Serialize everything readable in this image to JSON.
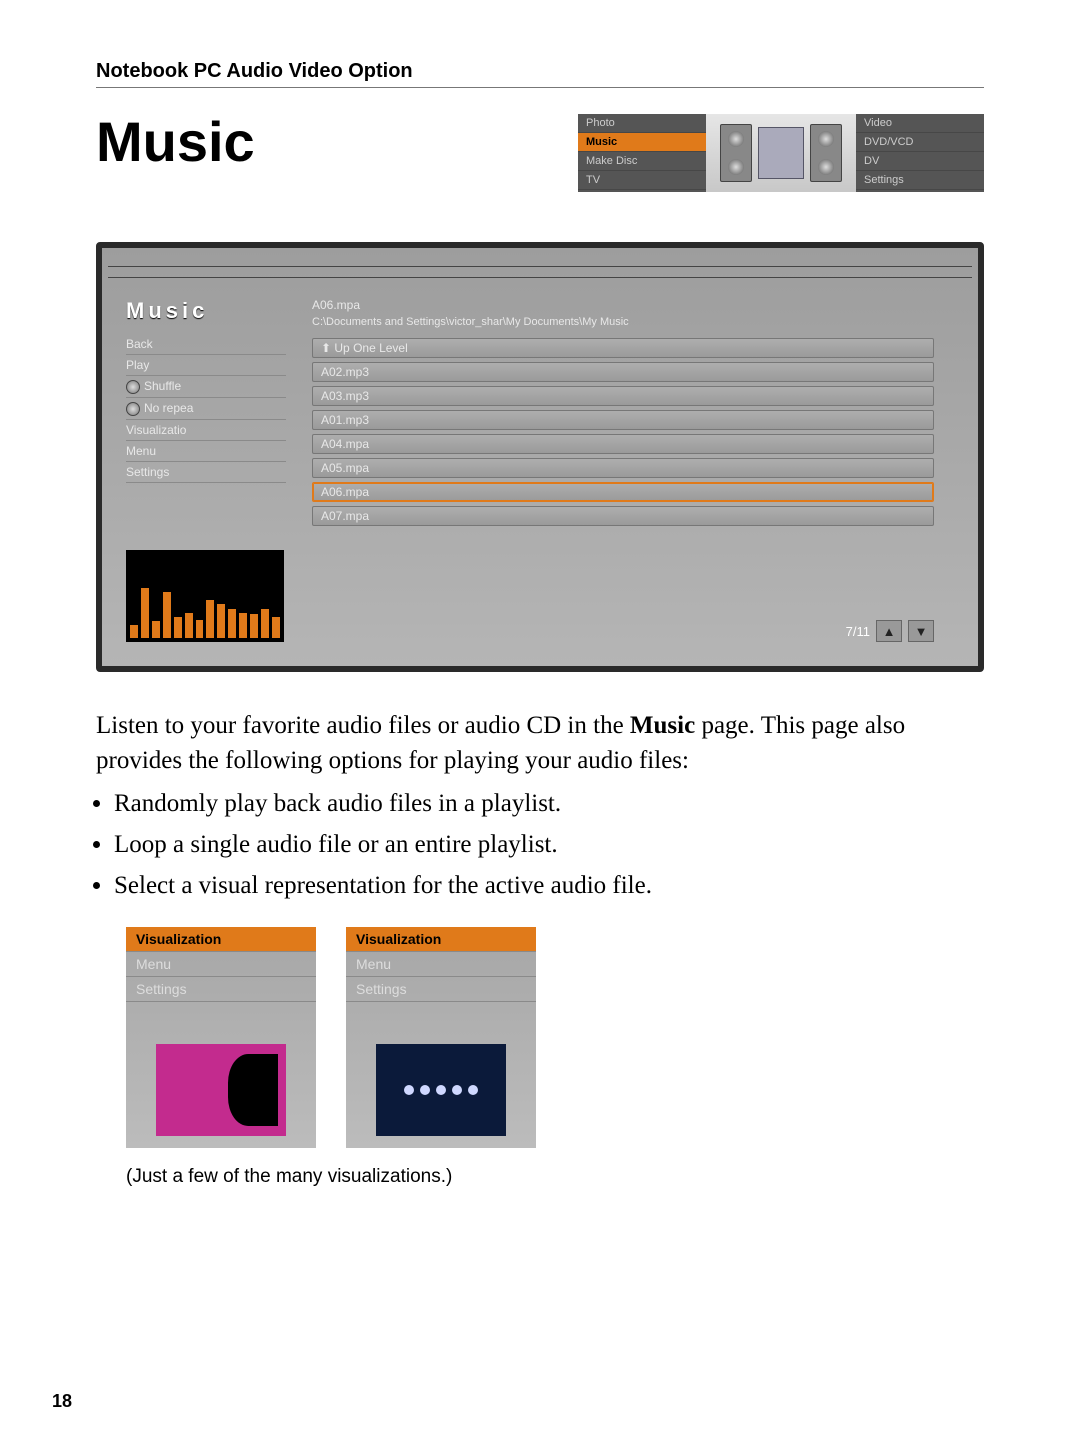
{
  "header": "Notebook PC Audio Video Option",
  "title": "Music",
  "menu_thumb": {
    "left": [
      "Photo",
      "Music",
      "Make Disc",
      "TV"
    ],
    "left_selected_index": 1,
    "right": [
      "Video",
      "DVD/VCD",
      "DV",
      "Settings"
    ]
  },
  "music_panel": {
    "title": "Music",
    "sidebar": [
      {
        "label": "Back",
        "toggle": false
      },
      {
        "label": "Play",
        "toggle": false
      },
      {
        "label": "Shuffle",
        "toggle": true
      },
      {
        "label": "No repea",
        "toggle": true
      },
      {
        "label": "Visualizatio",
        "toggle": false
      },
      {
        "label": "Menu",
        "toggle": false
      },
      {
        "label": "Settings",
        "toggle": false
      }
    ],
    "now_playing": "A06.mpa",
    "path": "C:\\Documents and Settings\\victor_shar\\My Documents\\My Music",
    "files": [
      {
        "label": "Up One Level",
        "up": true
      },
      {
        "label": "A02.mp3"
      },
      {
        "label": "A03.mp3"
      },
      {
        "label": "A01.mp3"
      },
      {
        "label": "A04.mpa"
      },
      {
        "label": "A05.mpa"
      },
      {
        "label": "A06.mpa",
        "selected": true
      },
      {
        "label": "A07.mpa"
      }
    ],
    "page_indicator": "7/11"
  },
  "body": {
    "para1_before": "Listen to your favorite audio files or audio CD in the ",
    "para1_bold": "Music",
    "para1_after": " page. This page also provides the following options for playing your audio files:",
    "bullets": [
      "Randomly play back audio files in a playlist.",
      "Loop a single audio file or an entire playlist.",
      "Select a visual representation for the active audio file."
    ]
  },
  "viz_cards": {
    "items": [
      "Visualization",
      "Menu",
      "Settings"
    ],
    "selected_index": 0
  },
  "caption": "(Just a few of the many visualizations.)",
  "page_number": "18",
  "chart_data": {
    "type": "bar",
    "description": "Audio equalizer visualization bars (approximate heights in % of box)",
    "categories": [
      "1",
      "2",
      "3",
      "4",
      "5",
      "6",
      "7",
      "8",
      "9",
      "10",
      "11",
      "12",
      "13",
      "14"
    ],
    "values": [
      15,
      60,
      20,
      55,
      25,
      30,
      22,
      45,
      40,
      35,
      30,
      28,
      35,
      25
    ]
  }
}
